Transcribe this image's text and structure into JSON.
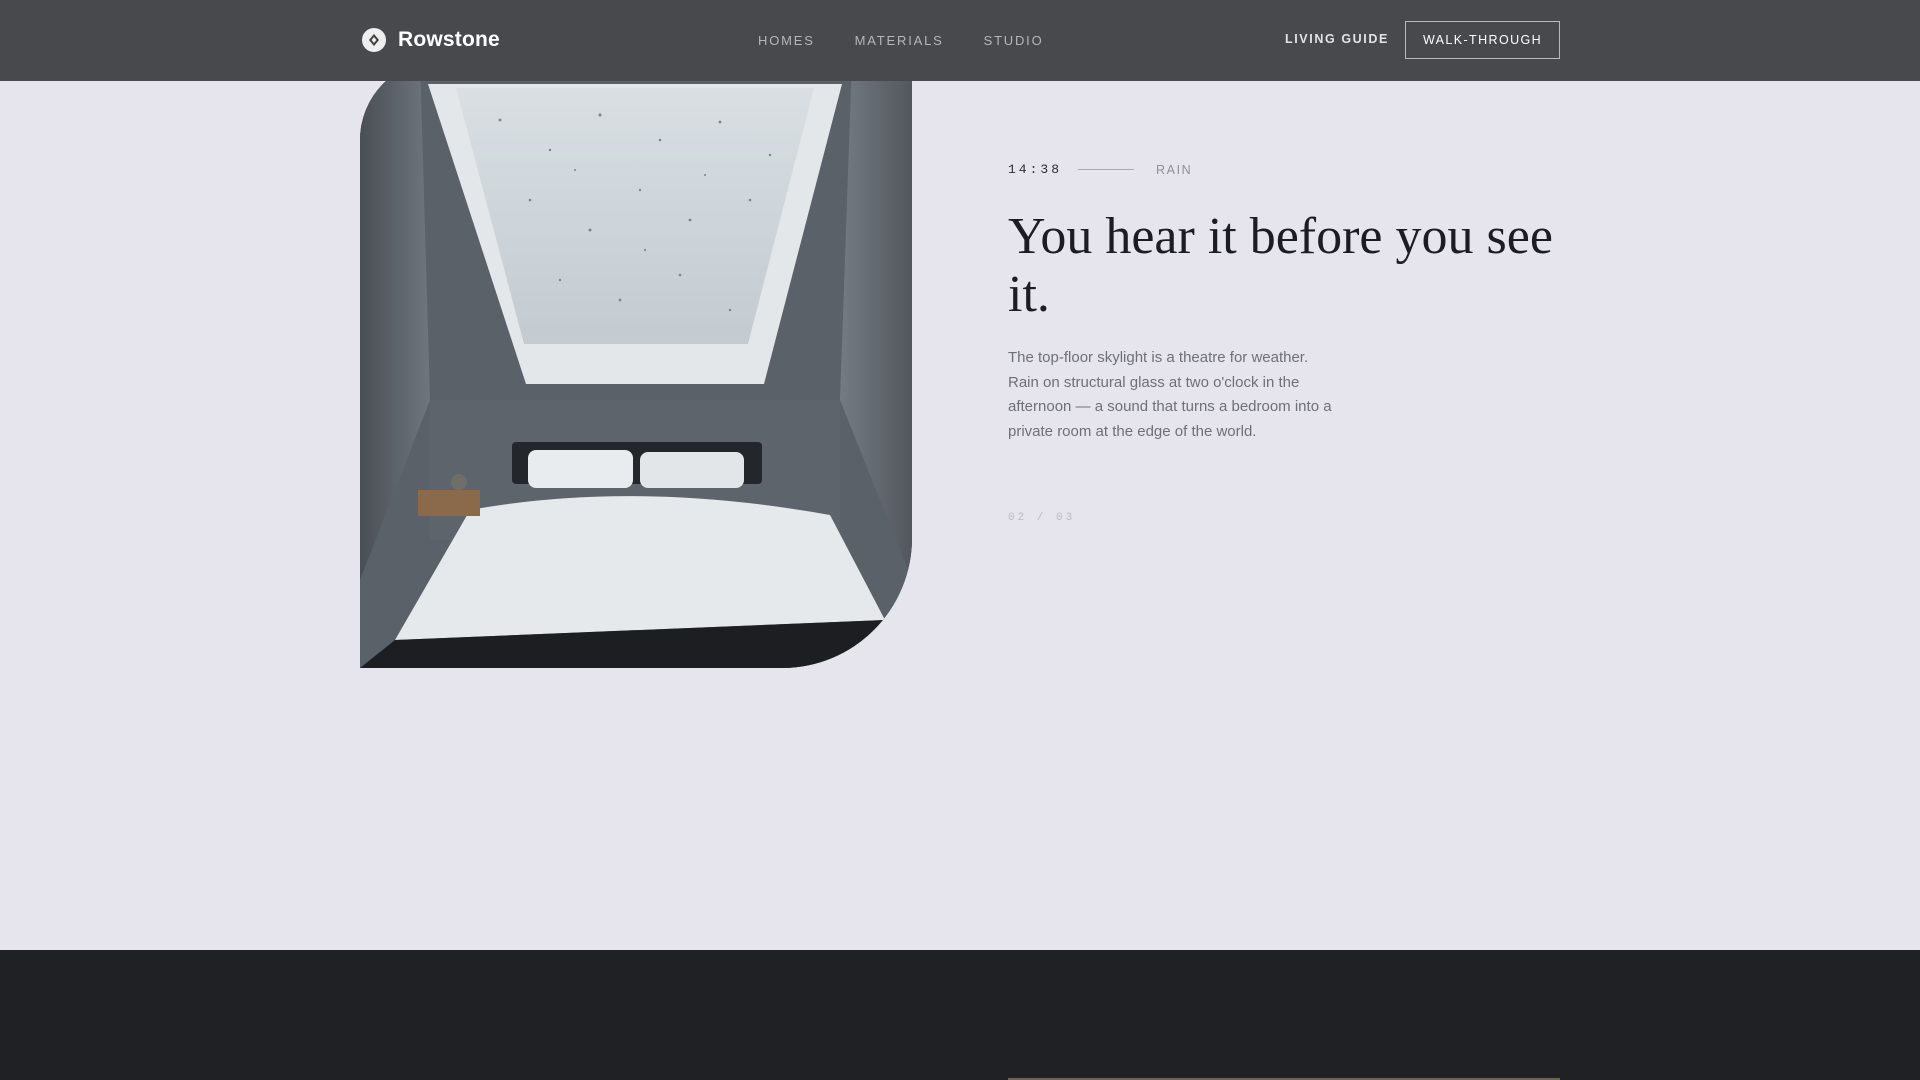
{
  "brand": {
    "name": "Rowstone",
    "mark_icon": "rowstone-logo-icon"
  },
  "nav": {
    "items": [
      "HOMES",
      "MATERIALS",
      "STUDIO"
    ]
  },
  "header": {
    "guide_label": "LIVING GUIDE",
    "cta_label": "WALK-THROUGH"
  },
  "scene": {
    "time": "14:38",
    "tag": "RAIN",
    "headline": "You hear it before you see it.",
    "body": "The top-floor skylight is a theatre for weather. Rain on structural glass at two o'clock in the afternoon — a sound that turns a bedroom into a private room at the edge of the world.",
    "pager": "02 / 03"
  },
  "colors": {
    "header_bg": "#48494d",
    "page_bg": "#e6e5ed",
    "footer_bg": "#202125",
    "headline": "#1c1d22"
  }
}
